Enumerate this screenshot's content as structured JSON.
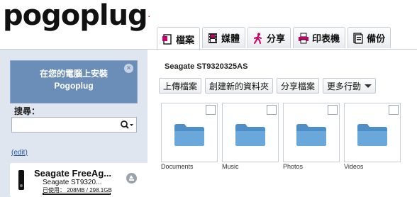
{
  "brand": {
    "logo_text": "pogoplug",
    "trademark": "."
  },
  "tabs": [
    {
      "label": "檔案",
      "icon": "file-icon",
      "active": true
    },
    {
      "label": "媒體",
      "icon": "film-icon",
      "active": false
    },
    {
      "label": "分享",
      "icon": "walking-person-icon",
      "active": false
    },
    {
      "label": "印表機",
      "icon": "printer-icon",
      "active": false
    },
    {
      "label": "備份",
      "icon": "backup-icon",
      "active": false
    }
  ],
  "sidebar": {
    "install_line1": "在您的電腦上安裝",
    "install_line2": "Pogoplug",
    "close_glyph": "×",
    "search_label": "搜尋：",
    "search_placeholder": "",
    "edit_link": "(edit)",
    "device": {
      "name": "Seagate FreeAg...",
      "drive": "Seagate ST9320...",
      "usage": "已使用： 208MB / 298.1GB",
      "used_fraction": 0.0007
    }
  },
  "main": {
    "drive_title": "Seagate ST9320325AS",
    "actions": {
      "upload": "上傳檔案",
      "new_folder": "創建新的資料夾",
      "share": "分享檔案",
      "more": "更多行動"
    },
    "folders": [
      {
        "name": "Documents"
      },
      {
        "name": "Music"
      },
      {
        "name": "Photos"
      },
      {
        "name": "Videos"
      }
    ]
  },
  "colors": {
    "accent": "#6b8eb8",
    "sidebar_bg": "#dfe6ef",
    "folder_blue": "#5a9bd1",
    "trademark": "#c8006a"
  }
}
